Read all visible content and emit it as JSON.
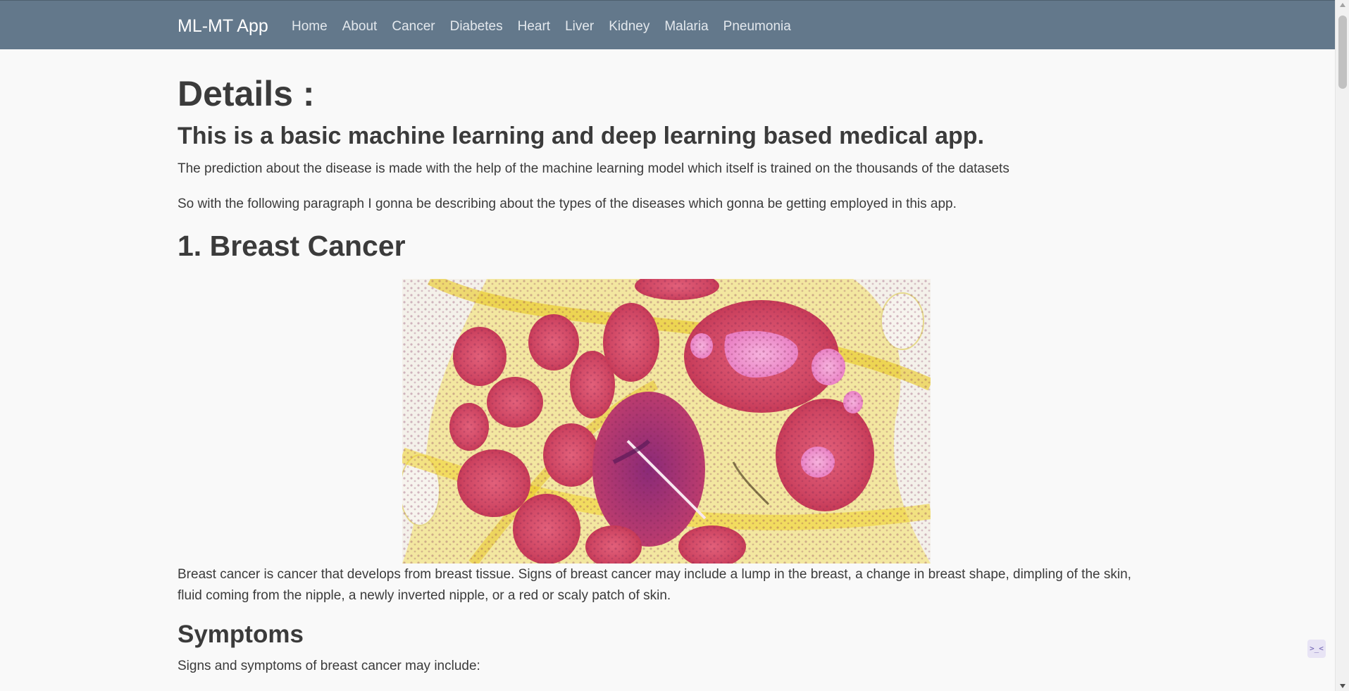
{
  "navbar": {
    "brand": "ML-MT App",
    "links": [
      "Home",
      "About",
      "Cancer",
      "Diabetes",
      "Heart",
      "Liver",
      "Kidney",
      "Malaria",
      "Pneumonia"
    ]
  },
  "main": {
    "title": "Details :",
    "subtitle": "This is a basic machine learning and deep learning based medical app.",
    "intro_1": "The prediction about the disease is made with the help of the machine learning model which itself is trained on the thousands of the datasets",
    "intro_2": "So with the following paragraph I gonna be describing about the types of the diseases which gonna be getting employed in this app.",
    "section_title": "1. Breast Cancer",
    "section_description": "Breast cancer is cancer that develops from breast tissue. Signs of breast cancer may include a lump in the breast, a change in breast shape, dimpling of the skin, fluid coming from the nipple, a newly inverted nipple, or a red or scaly patch of skin.",
    "symptoms_title": "Symptoms",
    "symptoms_intro": "Signs and symptoms of breast cancer may include:"
  },
  "widget": {
    "icon": ">_<"
  },
  "colors": {
    "navbar_bg": "#63788b",
    "page_bg": "#f9f9f9",
    "text": "#3b3b3b"
  }
}
